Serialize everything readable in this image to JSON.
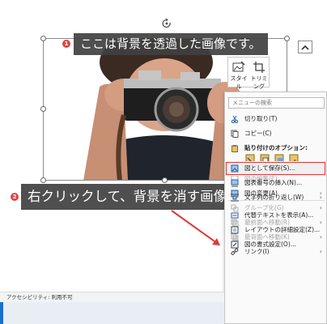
{
  "annotations": {
    "badge1": "1",
    "callout1": "ここは背景を透過した画像です。",
    "badge2": "2",
    "callout2": "右クリックして、背景を消す画像を保存します。"
  },
  "minibar": {
    "style_label": "スタイル",
    "crop_label": "トリミング"
  },
  "context_menu": {
    "search_placeholder": "メニューの検索",
    "items": [
      {
        "label": "切り取り(T)",
        "icon": "scissors-icon",
        "disabled": false
      },
      {
        "label": "コピー(C)",
        "icon": "copy-icon",
        "disabled": false
      },
      {
        "label": "貼り付けのオプション:",
        "icon": "paste-icon",
        "disabled": false
      },
      {
        "label": "図の編集(E)",
        "icon": "edit-icon",
        "disabled": true
      },
      {
        "label": "図の変更(A)",
        "icon": "change-picture-icon",
        "disabled": false
      },
      {
        "label": "グループ化(G)",
        "icon": "group-icon",
        "disabled": true
      },
      {
        "label": "最前面へ移動(R)",
        "icon": "bring-front-icon",
        "disabled": true
      },
      {
        "label": "最背面へ移動(K)",
        "icon": "send-back-icon",
        "disabled": true
      },
      {
        "label": "リンク(I)",
        "icon": "link-icon",
        "disabled": false
      },
      {
        "label": "図として保存(S)...",
        "icon": "save-as-picture-icon",
        "disabled": false
      },
      {
        "label": "図表番号の挿入(N)...",
        "icon": "caption-icon",
        "disabled": false
      },
      {
        "label": "文字列の折り返し(W)",
        "icon": "wrap-text-icon",
        "disabled": false
      },
      {
        "label": "代替テキストを表示(A)...",
        "icon": "alt-text-icon",
        "disabled": false
      },
      {
        "label": "レイアウトの詳細設定(Z)...",
        "icon": "layout-icon",
        "disabled": false
      },
      {
        "label": "図の書式設定(O)...",
        "icon": "format-picture-icon",
        "disabled": false
      }
    ]
  },
  "statusbar": {
    "accessibility": "アクセシビリティ: 利用不可"
  },
  "colors": {
    "callout_bg": "#404040",
    "badge": "#e04444",
    "highlight": "#e03a3a",
    "arrow": "#e03a3a"
  }
}
